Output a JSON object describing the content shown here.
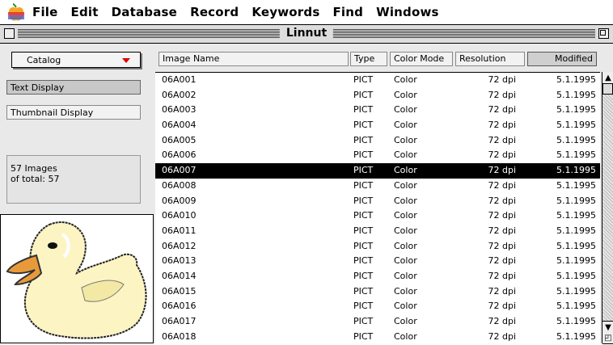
{
  "menubar": {
    "items": [
      "File",
      "Edit",
      "Database",
      "Record",
      "Keywords",
      "Find",
      "Windows"
    ]
  },
  "window": {
    "title": "Linnut"
  },
  "sidebar": {
    "catalog_select": "Catalog",
    "text_display": "Text Display",
    "thumbnail_display": "Thumbnail Display",
    "count_line1": "57 Images",
    "count_line2": "of total: 57"
  },
  "table": {
    "headers": [
      "Image Name",
      "Type",
      "Color Mode",
      "Resolution",
      "Modified"
    ],
    "rows": [
      [
        "06A001",
        "PICT",
        "Color",
        "72 dpi",
        "5.1.1995"
      ],
      [
        "06A002",
        "PICT",
        "Color",
        "72 dpi",
        "5.1.1995"
      ],
      [
        "06A003",
        "PICT",
        "Color",
        "72 dpi",
        "5.1.1995"
      ],
      [
        "06A004",
        "PICT",
        "Color",
        "72 dpi",
        "5.1.1995"
      ],
      [
        "06A005",
        "PICT",
        "Color",
        "72 dpi",
        "5.1.1995"
      ],
      [
        "06A006",
        "PICT",
        "Color",
        "72 dpi",
        "5.1.1995"
      ],
      [
        "06A007",
        "PICT",
        "Color",
        "72 dpi",
        "5.1.1995"
      ],
      [
        "06A008",
        "PICT",
        "Color",
        "72 dpi",
        "5.1.1995"
      ],
      [
        "06A009",
        "PICT",
        "Color",
        "72 dpi",
        "5.1.1995"
      ],
      [
        "06A010",
        "PICT",
        "Color",
        "72 dpi",
        "5.1.1995"
      ],
      [
        "06A011",
        "PICT",
        "Color",
        "72 dpi",
        "5.1.1995"
      ],
      [
        "06A012",
        "PICT",
        "Color",
        "72 dpi",
        "5.1.1995"
      ],
      [
        "06A013",
        "PICT",
        "Color",
        "72 dpi",
        "5.1.1995"
      ],
      [
        "06A014",
        "PICT",
        "Color",
        "72 dpi",
        "5.1.1995"
      ],
      [
        "06A015",
        "PICT",
        "Color",
        "72 dpi",
        "5.1.1995"
      ],
      [
        "06A016",
        "PICT",
        "Color",
        "72 dpi",
        "5.1.1995"
      ],
      [
        "06A017",
        "PICT",
        "Color",
        "72 dpi",
        "5.1.1995"
      ],
      [
        "06A018",
        "PICT",
        "Color",
        "72 dpi",
        "5.1.1995"
      ]
    ],
    "selected_row": "06A007"
  },
  "icons": {
    "apple": "apple-logo-icon",
    "scroll_up": "arrow-up-icon",
    "scroll_down": "arrow-down-icon",
    "dropdown": "triangle-down-icon",
    "preview": "duck-thumbnail"
  },
  "colors": {
    "selection": "#000000",
    "dropdown_arrow": "#dd0000"
  }
}
